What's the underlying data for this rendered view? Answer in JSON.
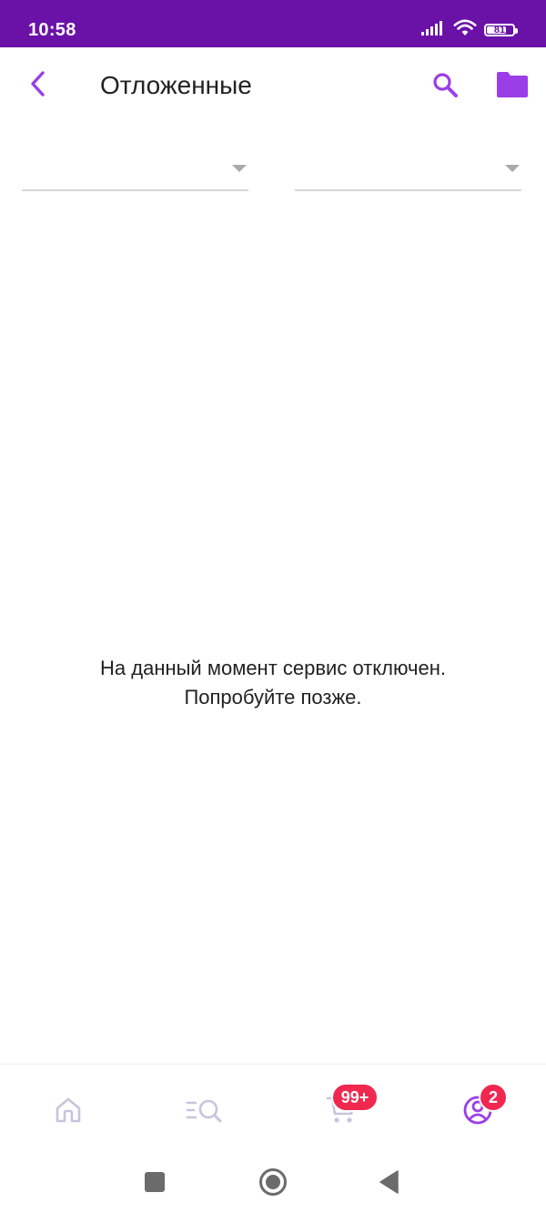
{
  "status_bar": {
    "time": "10:58",
    "battery": "81",
    "battery_level": 0.81,
    "icons": [
      "signal-icon",
      "wifi-icon",
      "battery-icon"
    ]
  },
  "app_bar": {
    "title": "Отложенные",
    "back_icon": "chevron-left-icon",
    "search_icon": "search-icon",
    "folder_icon": "folder-icon"
  },
  "filters": {
    "left": {
      "value": ""
    },
    "right": {
      "value": ""
    }
  },
  "message": {
    "line1": "На данный момент сервис отключен.",
    "line2": "Попробуйте позже."
  },
  "bottom_nav": {
    "items": [
      {
        "icon": "home-icon"
      },
      {
        "icon": "catalog-search-icon"
      },
      {
        "icon": "cart-icon",
        "badge": "99+"
      },
      {
        "icon": "profile-icon",
        "badge": "2"
      }
    ]
  },
  "colors": {
    "accent": "#9b3ee8",
    "status_bar": "#6a11a8",
    "badge": "#f0284f",
    "nav_inactive": "#c9c4dc",
    "text": "#222222"
  }
}
